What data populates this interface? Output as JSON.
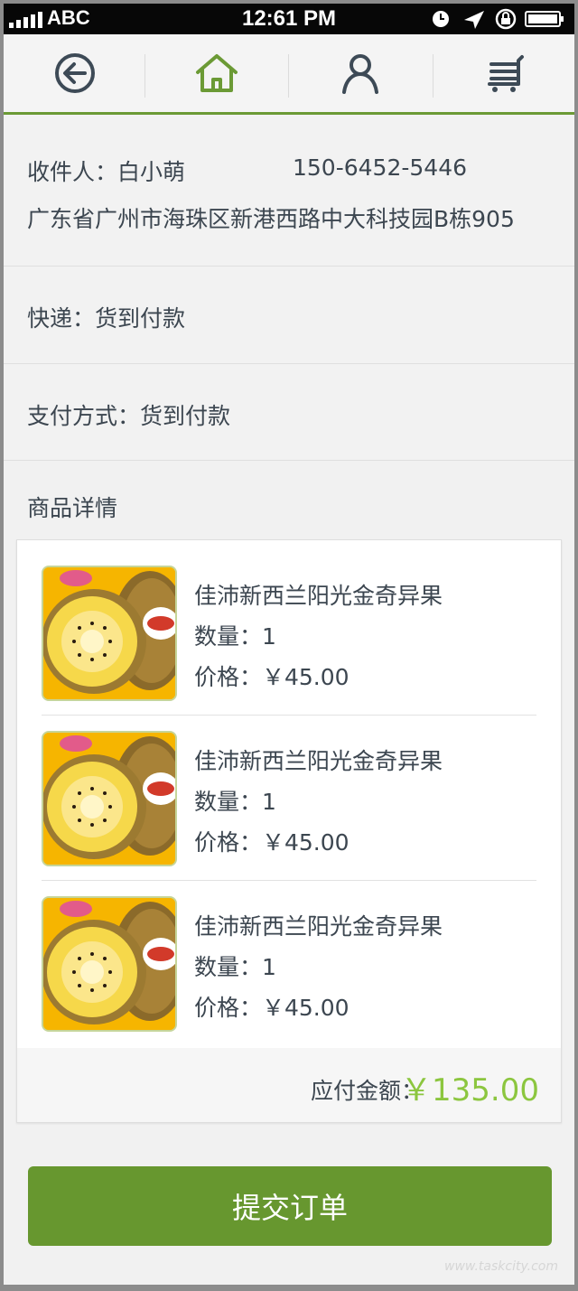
{
  "status_bar": {
    "carrier": "ABC",
    "time": "12:61 PM"
  },
  "toolbar": {
    "back_icon": "back-arrow-icon",
    "home_icon": "home-icon",
    "user_icon": "user-icon",
    "cart_icon": "cart-icon",
    "accent": "#6b9a35"
  },
  "recipient": {
    "label": "收件人：白小萌",
    "phone": "150-6452-5446",
    "address": "广东省广州市海珠区新港西路中大科技园B栋905"
  },
  "delivery": {
    "label": "快递：货到付款"
  },
  "payment": {
    "label": "支付方式：货到付款"
  },
  "details": {
    "heading": "商品详情"
  },
  "items": [
    {
      "name": "佳沛新西兰阳光金奇异果",
      "qty": "数量：1",
      "price": "价格：￥45.00"
    },
    {
      "name": "佳沛新西兰阳光金奇异果",
      "qty": "数量：1",
      "price": "价格：￥45.00"
    },
    {
      "name": "佳沛新西兰阳光金奇异果",
      "qty": "数量：1",
      "price": "价格：￥45.00"
    }
  ],
  "total": {
    "label": "应付金额：",
    "value": "￥135.00",
    "color": "#8cc63f"
  },
  "submit": {
    "label": "提交订单",
    "color": "#67972f"
  },
  "watermark": "www.taskcity.com"
}
